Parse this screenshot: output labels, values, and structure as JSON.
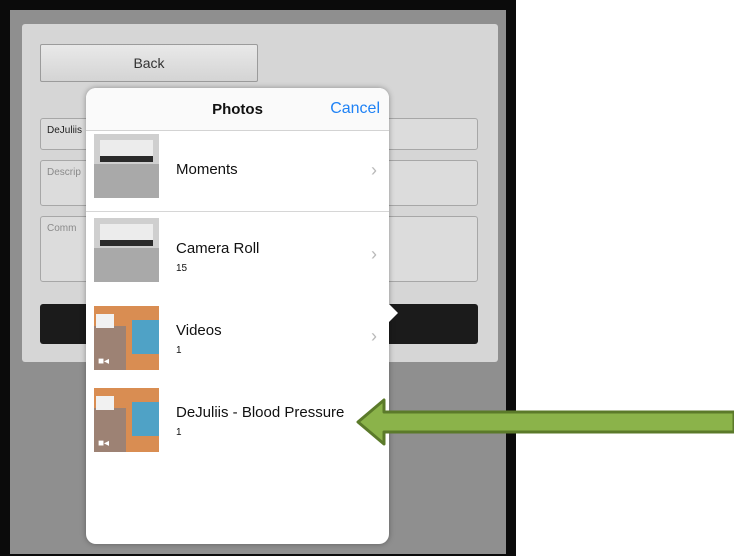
{
  "background_form": {
    "back_label": "Back",
    "field1_value": "DeJuliis",
    "field2_placeholder": "Descrip",
    "field3_placeholder": "Comm"
  },
  "popover": {
    "title": "Photos",
    "cancel_label": "Cancel",
    "albums": [
      {
        "name": "Moments",
        "count": "",
        "thumb": "screen"
      },
      {
        "name": "Camera Roll",
        "count": "15",
        "thumb": "screen"
      },
      {
        "name": "Videos",
        "count": "1",
        "thumb": "video"
      },
      {
        "name": "DeJuliis - Blood Pressure",
        "count": "1",
        "thumb": "video"
      }
    ]
  },
  "colors": {
    "accent": "#1f82f5",
    "arrow_fill": "#8bb34a",
    "arrow_stroke": "#5b7a2a"
  },
  "icons": [
    "chevron-right-icon",
    "video-camera-icon",
    "green-pointer-arrow"
  ]
}
